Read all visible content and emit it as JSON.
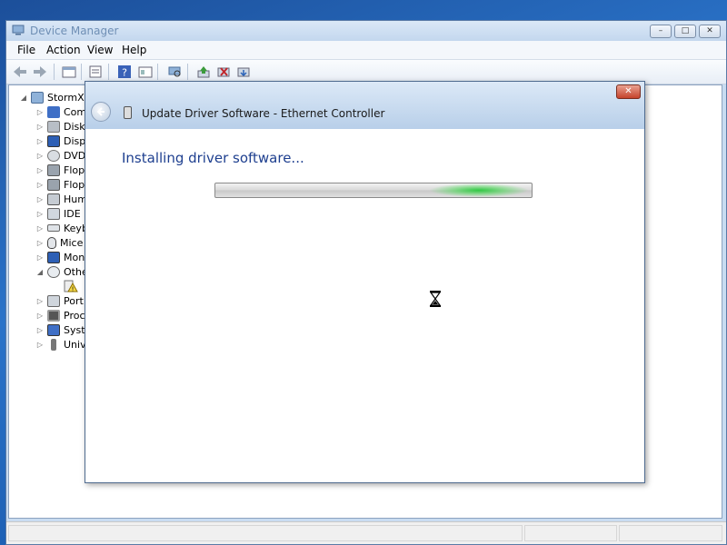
{
  "main_window": {
    "title": "Device Manager",
    "controls": {
      "minimize": "–",
      "maximize": "□",
      "close": "✕"
    }
  },
  "menu": {
    "file": "File",
    "action": "Action",
    "view": "View",
    "help": "Help"
  },
  "toolbar": {
    "icons": [
      "back-icon",
      "forward-icon",
      "properties-icon",
      "update-driver-icon",
      "help-icon",
      "view-icon",
      "scan-hardware-icon",
      "update-icon",
      "uninstall-icon",
      "disable-icon"
    ]
  },
  "tree": {
    "root": "StormXP",
    "items": [
      "Com",
      "Disk",
      "Disp",
      "DVD",
      "Flop",
      "Flop",
      "Hum",
      "IDE",
      "Keyb",
      "Mice",
      "Mon",
      "Othe",
      "",
      "Port",
      "Proc",
      "Syst",
      "Univ"
    ]
  },
  "dialog": {
    "title": "Update Driver Software - Ethernet Controller",
    "heading": "Installing driver software...",
    "close": "✕",
    "progress_state": "indeterminate"
  },
  "colors": {
    "heading": "#1e3f8f",
    "progress_glow": "#2ec83c",
    "desktop": "#2a73c9"
  }
}
